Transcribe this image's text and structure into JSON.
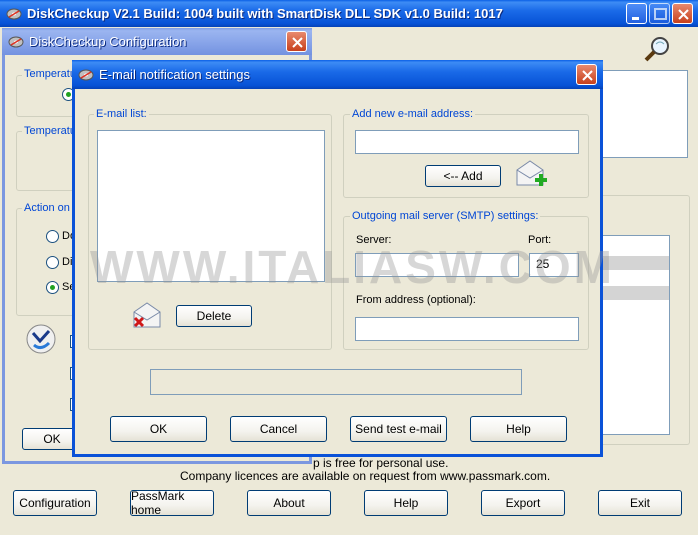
{
  "main_window": {
    "title": "DiskCheckup V2.1 Build: 1004 built with SmartDisk DLL SDK v1.0 Build: 1017",
    "footer_line1": "p is free for personal use.",
    "footer_line2": "Company licences are available on request from www.passmark.com.",
    "buttons": {
      "configuration": "Configuration",
      "passmark_home": "PassMark home",
      "about": "About",
      "help": "Help",
      "export": "Export",
      "exit": "Exit"
    }
  },
  "config_window": {
    "title": "DiskCheckup Configuration",
    "group_temp1": "Temperatu",
    "group_temp2": "Temperatu",
    "group_action": "Action on",
    "radio1": "Do",
    "radio2": "Dis",
    "radio3": "Se",
    "ok_label": "OK"
  },
  "email_dialog": {
    "title": "E-mail notification settings",
    "email_list_label": "E-mail list:",
    "delete_label": "Delete",
    "add_address_label": "Add new e-mail address:",
    "add_button": "<-- Add",
    "smtp_group_label": "Outgoing mail server (SMTP) settings:",
    "server_label": "Server:",
    "server_value": "",
    "port_label": "Port:",
    "port_value": "25",
    "from_label": "From address (optional):",
    "from_value": "",
    "new_email_value": "",
    "status_text": "",
    "buttons": {
      "ok": "OK",
      "cancel": "Cancel",
      "send_test": "Send test e-mail",
      "help": "Help"
    }
  },
  "watermark": "WWW.ITALIASW.COM",
  "icons": {
    "app": "app-disk-icon",
    "search": "magnifier-icon",
    "add_mail": "add-mail-icon",
    "delete_mail": "delete-mail-icon",
    "refresh": "refresh-icon"
  }
}
